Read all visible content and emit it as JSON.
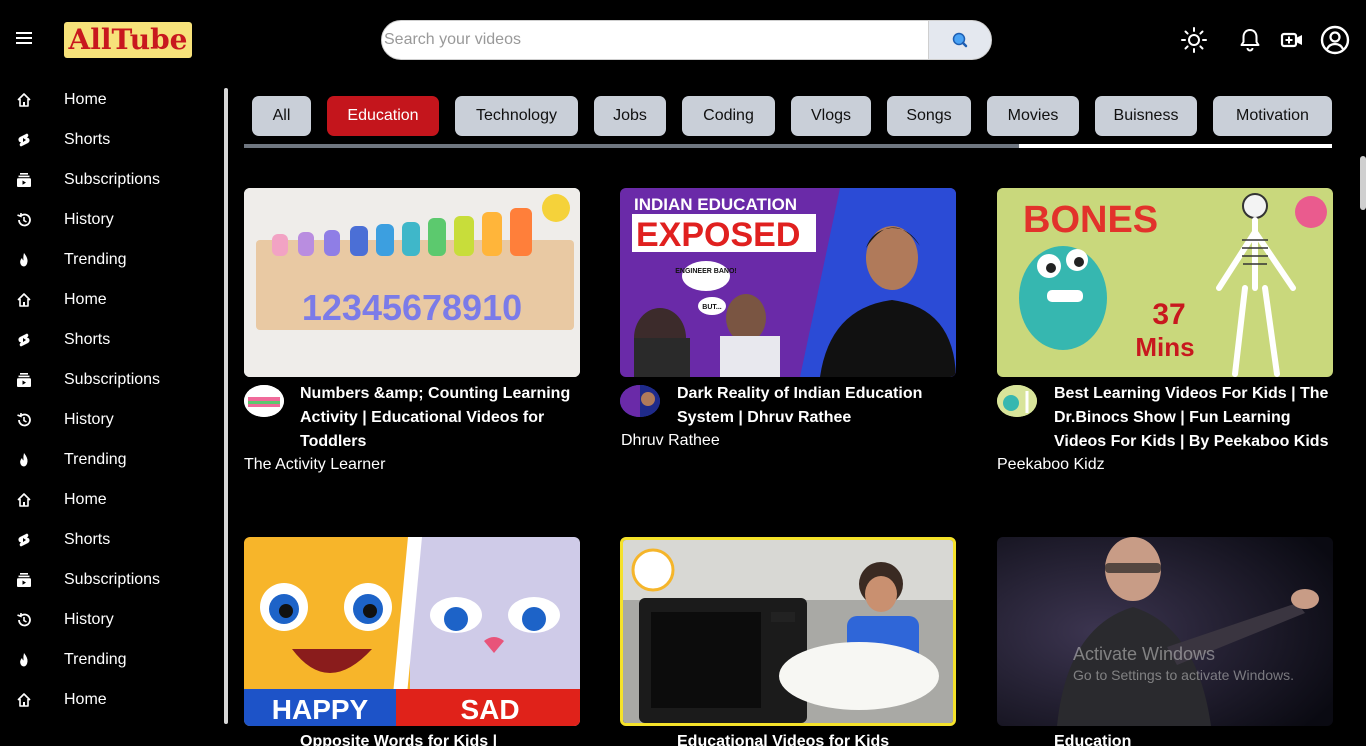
{
  "app": {
    "logo": "AllTube"
  },
  "search": {
    "placeholder": "Search your videos"
  },
  "header_icons": [
    "sun-icon",
    "bell-icon",
    "video-camera-icon",
    "account-icon"
  ],
  "sidebar": {
    "items": [
      {
        "label": "Home",
        "icon": "home-icon"
      },
      {
        "label": "Shorts",
        "icon": "shorts-icon"
      },
      {
        "label": "Subscriptions",
        "icon": "subscriptions-icon"
      },
      {
        "label": "History",
        "icon": "history-icon"
      },
      {
        "label": "Trending",
        "icon": "fire-icon"
      },
      {
        "label": "Home",
        "icon": "home-icon"
      },
      {
        "label": "Shorts",
        "icon": "shorts-icon"
      },
      {
        "label": "Subscriptions",
        "icon": "subscriptions-icon"
      },
      {
        "label": "History",
        "icon": "history-icon"
      },
      {
        "label": "Trending",
        "icon": "fire-icon"
      },
      {
        "label": "Home",
        "icon": "home-icon"
      },
      {
        "label": "Shorts",
        "icon": "shorts-icon"
      },
      {
        "label": "Subscriptions",
        "icon": "subscriptions-icon"
      },
      {
        "label": "History",
        "icon": "history-icon"
      },
      {
        "label": "Trending",
        "icon": "fire-icon"
      },
      {
        "label": "Home",
        "icon": "home-icon"
      }
    ]
  },
  "chips": {
    "items": [
      "All",
      "Education",
      "Technology",
      "Jobs",
      "Coding",
      "Vlogs",
      "Songs",
      "Movies",
      "Buisness",
      "Motivation"
    ],
    "active": "Education"
  },
  "videos": [
    {
      "title_1": "Numbers &amp; Counting Learning",
      "title_2": "Activity | Educational Videos for",
      "title_3": "Toddlers",
      "channel": "The Activity Learner",
      "thumb_text": "12345678910"
    },
    {
      "title_1": "Dark Reality of Indian Education",
      "title_2": "System | Dhruv Rathee",
      "title_3": "",
      "channel": "Dhruv Rathee",
      "thumb_text": "INDIAN EDUCATION",
      "thumb_text_2": "EXPOSED",
      "thumb_bubble_1": "ENGINEER BANO!",
      "thumb_bubble_2": "BUT..."
    },
    {
      "title_1": "Best Learning Videos For Kids | The",
      "title_2": "Dr.Binocs Show | Fun Learning",
      "title_3": "Videos For Kids | By Peekaboo Kids",
      "channel": "Peekaboo Kidz",
      "thumb_text": "BONES",
      "thumb_text_2": "37",
      "thumb_text_3": "Mins"
    },
    {
      "title_1": "Opposite Words for Kids |",
      "channel": "",
      "thumb_text": "HAPPY",
      "thumb_text_2": "SAD"
    },
    {
      "title_1": "Educational Videos for Kids",
      "channel": ""
    },
    {
      "title_1": "Education",
      "channel": ""
    }
  ],
  "watermark": {
    "line1": "Activate Windows",
    "line2": "Go to Settings to activate Windows."
  }
}
